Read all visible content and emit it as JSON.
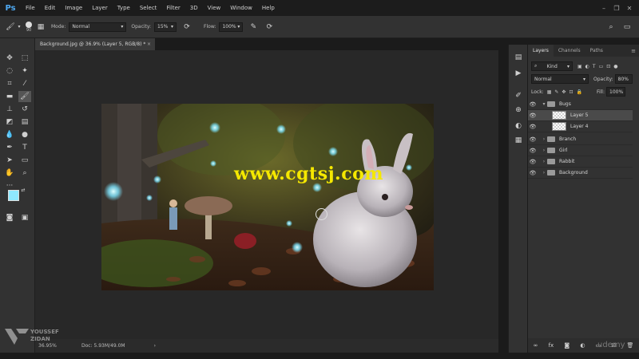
{
  "app": {
    "logo": "Ps"
  },
  "menu": [
    "File",
    "Edit",
    "Image",
    "Layer",
    "Type",
    "Select",
    "Filter",
    "3D",
    "View",
    "Window",
    "Help"
  ],
  "options": {
    "brush_size": "90",
    "mode_label": "Mode:",
    "mode_value": "Normal",
    "opacity_label": "Opacity:",
    "opacity_value": "15%",
    "flow_label": "Flow:",
    "flow_value": "100%"
  },
  "document": {
    "tab_title": "Background.jpg @ 36.9% (Layer 5, RGB/8) *",
    "zoom": "36.95%",
    "doc_info": "Doc: 5.93M/49.0M"
  },
  "watermark_text": "www.cgtsj.com",
  "layers_panel": {
    "tabs": [
      "Layers",
      "Channels",
      "Paths"
    ],
    "filter_kind": "Kind",
    "blend_mode": "Normal",
    "opacity_label": "Opacity:",
    "opacity_value": "80%",
    "lock_label": "Lock:",
    "fill_label": "Fill:",
    "fill_value": "100%",
    "layers": [
      {
        "name": "Bugs",
        "type": "group",
        "expanded": true
      },
      {
        "name": "Layer 5",
        "type": "layer",
        "selected": true
      },
      {
        "name": "Layer 4",
        "type": "layer"
      },
      {
        "name": "Branch",
        "type": "group"
      },
      {
        "name": "Girl",
        "type": "group"
      },
      {
        "name": "Rabbit",
        "type": "group"
      },
      {
        "name": "Background",
        "type": "group"
      }
    ]
  },
  "branding": {
    "author_line1": "YOUSSEF",
    "author_line2": "ZIDAN",
    "platform": "udemy"
  },
  "colors": {
    "foreground": "#8fe8ff",
    "background": "#ffffff",
    "accent": "#4ea8f0",
    "watermark": "#f5e800"
  }
}
